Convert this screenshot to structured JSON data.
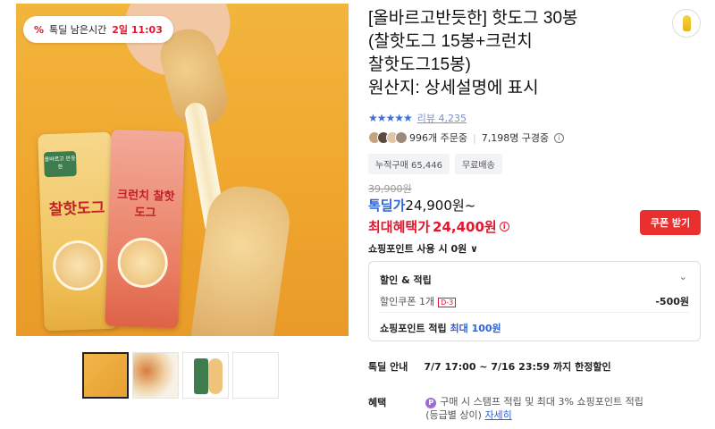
{
  "gallery": {
    "timer": {
      "label": "톡딜 남은시간",
      "remaining": "2일 11:03",
      "icon": "percent-icon"
    },
    "pack_left_title": "찰핫도그",
    "pack_right_title": "크런치 찰핫도그",
    "brand_text": "올바르고 반듯한"
  },
  "product": {
    "title_lines": [
      "[올바르고반듯한] 핫도그 30봉",
      "(찰핫도그 15봉+크런치",
      "찰핫도그15봉)",
      "원산지: 상세설명에 표시"
    ],
    "rating": {
      "stars": "★★★★★",
      "review_label": "리뷰",
      "review_count": "4,235"
    },
    "orders": "996개 주문중",
    "viewers": "7,198명 구경중",
    "chips": [
      "누적구매 65,446",
      "무료배송"
    ],
    "original_price": "39,900원",
    "deal_price_label": "톡딜가",
    "deal_price": "24,900원~",
    "max_benefit_label": "최대혜택가",
    "max_benefit_price": "24,400원",
    "coupon_button": "쿠폰 받기",
    "points_use": "쇼핑포인트 사용 시 0원 ∨"
  },
  "discount": {
    "header": "할인 & 적립",
    "coupon_label": "할인쿠폰 1개",
    "coupon_dday": "D-3",
    "coupon_amount": "-500원",
    "points_prefix": "쇼핑포인트 적립",
    "points_max": "최대 100원"
  },
  "deal_info": {
    "key": "톡딜 안내",
    "value": "7/7 17:00 ~ 7/16 23:59 까지 한정할인"
  },
  "benefit": {
    "key": "혜택",
    "line1": "구매 시 스탬프 적립 및 최대 3% 쇼핑포인트 적립",
    "line2": "(등급별 상이)",
    "more": "자세히"
  },
  "colors": {
    "accent_red": "#e3162e",
    "accent_blue": "#2f63d8",
    "coupon_bg": "#ea2f2f"
  }
}
